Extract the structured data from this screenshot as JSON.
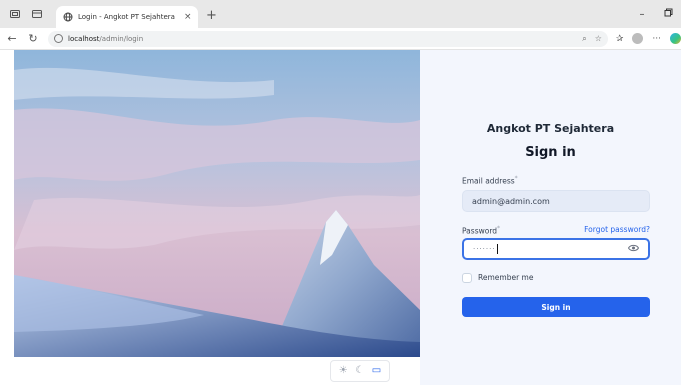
{
  "browser": {
    "tab_title": "Login - Angkot PT Sejahtera",
    "tab_close": "×",
    "new_tab": "+",
    "url_host": "localhost",
    "url_path": "/admin/login",
    "minimize": "–",
    "restore": "ⅆ"
  },
  "login": {
    "brand": "Angkot PT Sejahtera",
    "title": "Sign in",
    "email_label": "Email address",
    "required_mark": "*",
    "email_value": "admin@admin.com",
    "password_label": "Password",
    "password_dots": "·······",
    "forgot_link": "Forgot password?",
    "remember_label": "Remember me",
    "submit_label": "Sign in"
  },
  "theme_switch": {
    "light_icon": "☀",
    "dark_icon": "☾",
    "system_icon": "▭"
  },
  "colors": {
    "primary": "#2563eb",
    "panel_bg": "#f3f6fd"
  }
}
